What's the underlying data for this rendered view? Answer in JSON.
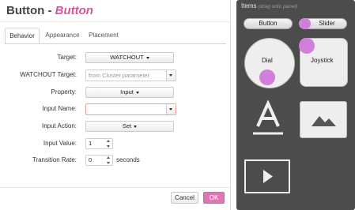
{
  "dialog": {
    "title_prefix": "Button",
    "title_sep": " - ",
    "title_name": "Button",
    "tabs": [
      {
        "label": "Behavior",
        "active": true
      },
      {
        "label": "Appearance",
        "active": false
      },
      {
        "label": "Placement",
        "active": false
      }
    ],
    "fields": {
      "target": {
        "label": "Target:",
        "value": "WATCHOUT"
      },
      "watchout_target": {
        "label": "WATCHOUT Target:",
        "placeholder": "from Cluster parameter"
      },
      "property": {
        "label": "Property:",
        "value": "Input"
      },
      "input_name": {
        "label": "Input Name:",
        "value": ""
      },
      "input_action": {
        "label": "Input Action:",
        "value": "Set"
      },
      "input_value": {
        "label": "Input Value:",
        "value": "1"
      },
      "transition_rate": {
        "label": "Transition Rate:",
        "value": "0",
        "unit": "seconds"
      }
    },
    "cancel_label": "Cancel",
    "ok_label": "OK",
    "colors": {
      "accent": "#d2569a",
      "ok_button": "#df76b3",
      "invalid_border": "#e9a0a0"
    }
  },
  "items_panel": {
    "title": "Items",
    "hint": "(drag onto panel)",
    "items": {
      "button": {
        "label": "Button"
      },
      "slider": {
        "label": "Slider"
      },
      "dial": {
        "label": "Dial"
      },
      "joystick": {
        "label": "Joystick"
      },
      "text": {
        "icon": "text-icon"
      },
      "image": {
        "icon": "image-icon"
      },
      "video": {
        "icon": "play-icon"
      }
    },
    "colors": {
      "background": "#4c4c4c",
      "handle": "#d27fdc"
    }
  }
}
